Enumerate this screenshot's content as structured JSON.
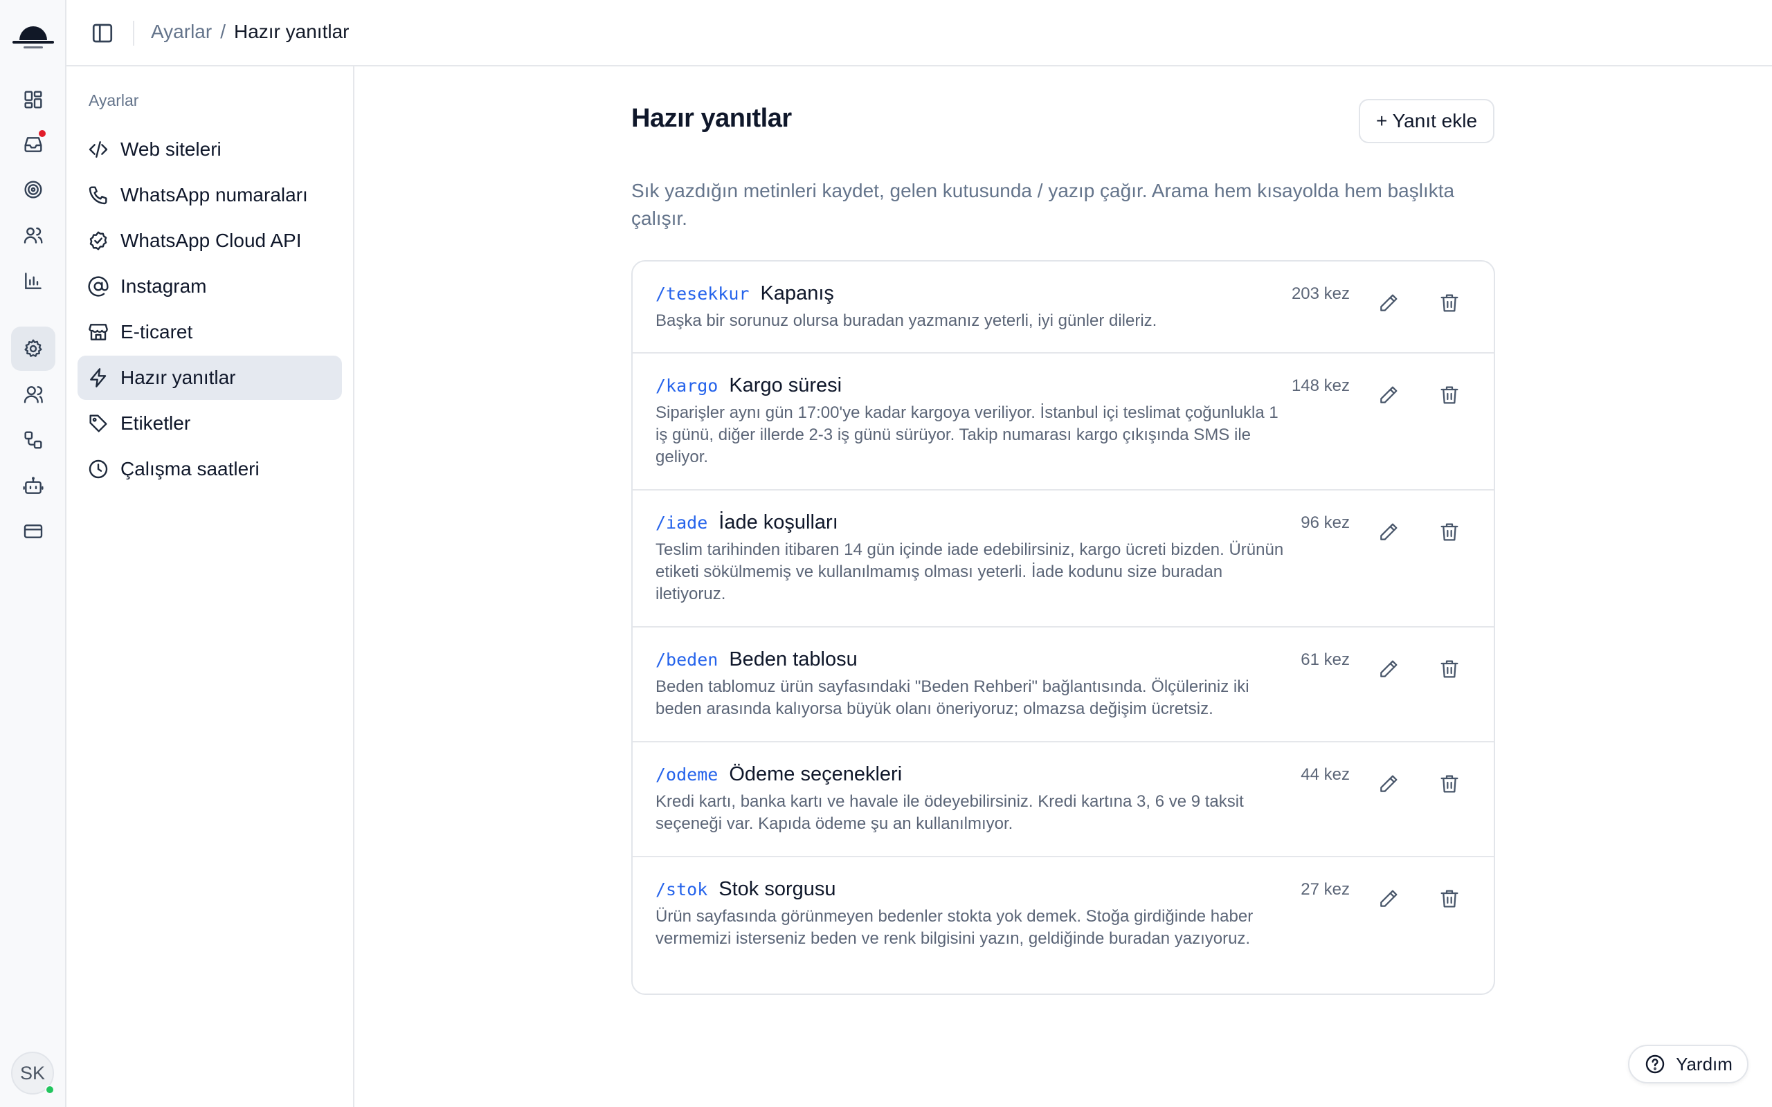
{
  "breadcrumb": {
    "parent": "Ayarlar",
    "separator": "/",
    "current": "Hazır yanıtlar"
  },
  "rail": {
    "items": [
      {
        "icon": "dashboard-icon"
      },
      {
        "icon": "inbox-icon",
        "has_notification": true
      },
      {
        "icon": "target-icon"
      },
      {
        "icon": "users-icon"
      },
      {
        "icon": "bar-chart-icon"
      },
      {
        "icon": "gear-icon",
        "active": true
      },
      {
        "icon": "team-icon"
      },
      {
        "icon": "workflow-icon"
      },
      {
        "icon": "bot-icon"
      },
      {
        "icon": "credit-card-icon"
      }
    ],
    "avatar_initials": "SK",
    "avatar_status_color": "#22c55e"
  },
  "settings": {
    "heading": "Ayarlar",
    "items": [
      {
        "label": "Web siteleri",
        "icon": "code-icon"
      },
      {
        "label": "WhatsApp numaraları",
        "icon": "phone-icon"
      },
      {
        "label": "WhatsApp Cloud API",
        "icon": "badge-check-icon"
      },
      {
        "label": "Instagram",
        "icon": "at-sign-icon"
      },
      {
        "label": "E-ticaret",
        "icon": "store-icon"
      },
      {
        "label": "Hazır yanıtlar",
        "icon": "zap-icon",
        "active": true
      },
      {
        "label": "Etiketler",
        "icon": "tag-icon"
      },
      {
        "label": "Çalışma saatleri",
        "icon": "clock-icon"
      }
    ]
  },
  "main": {
    "title": "Hazır yanıtlar",
    "add_button": "+ Yanıt ekle",
    "description": "Sık yazdığın metinleri kaydet, gelen kutusunda / yazıp çağır. Arama hem kısayolda hem başlıkta çalışır.",
    "replies": [
      {
        "shortcut": "/tesekkur",
        "title": "Kapanış",
        "body": "Başka bir sorunuz olursa buradan yazmanız yeterli, iyi günler dileriz.",
        "count": "203 kez"
      },
      {
        "shortcut": "/kargo",
        "title": "Kargo süresi",
        "body": "Siparişler aynı gün 17:00'ye kadar kargoya veriliyor. İstanbul içi teslimat çoğunlukla 1 iş günü, diğer illerde 2-3 iş günü sürüyor. Takip numarası kargo çıkışında SMS ile geliyor.",
        "count": "148 kez"
      },
      {
        "shortcut": "/iade",
        "title": "İade koşulları",
        "body": "Teslim tarihinden itibaren 14 gün içinde iade edebilirsiniz, kargo ücreti bizden. Ürünün etiketi sökülmemiş ve kullanılmamış olması yeterli. İade kodunu size buradan iletiyoruz.",
        "count": "96 kez"
      },
      {
        "shortcut": "/beden",
        "title": "Beden tablosu",
        "body": "Beden tablomuz ürün sayfasındaki \"Beden Rehberi\" bağlantısında. Ölçüleriniz iki beden arasında kalıyorsa büyük olanı öneriyoruz; olmazsa değişim ücretsiz.",
        "count": "61 kez"
      },
      {
        "shortcut": "/odeme",
        "title": "Ödeme seçenekleri",
        "body": "Kredi kartı, banka kartı ve havale ile ödeyebilirsiniz. Kredi kartına 3, 6 ve 9 taksit seçeneği var. Kapıda ödeme şu an kullanılmıyor.",
        "count": "44 kez"
      },
      {
        "shortcut": "/stok",
        "title": "Stok sorgusu",
        "body": "Ürün sayfasında görünmeyen bedenler stokta yok demek. Stoğa girdiğinde haber vermemizi isterseniz beden ve renk bilgisini yazın, geldiğinde buradan yazıyoruz.",
        "count": "27 kez"
      }
    ]
  },
  "help": {
    "label": "Yardım",
    "icon": "help-circle-icon"
  },
  "colors": {
    "accent": "#2563eb",
    "notification": "#e11d2a",
    "active_bg": "#e5e9f0"
  }
}
